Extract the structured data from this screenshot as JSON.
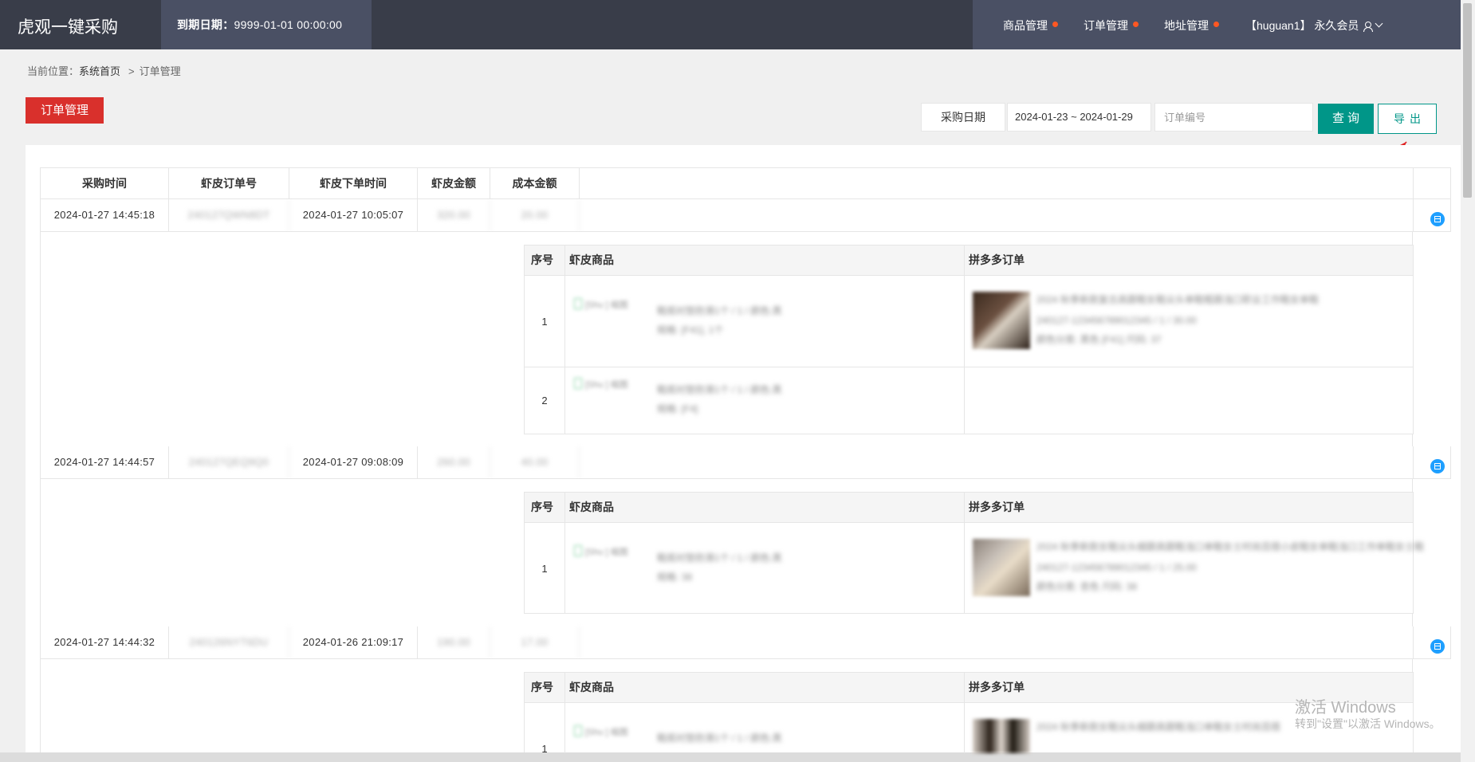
{
  "app": {
    "title": "虎观一键采购"
  },
  "expire": {
    "label": "到期日期：",
    "value": "9999-01-01 00:00:00"
  },
  "nav": {
    "items": [
      {
        "label": "商品管理",
        "dot_color": "#ff5722"
      },
      {
        "label": "订单管理",
        "dot_color": "#ff5722"
      },
      {
        "label": "地址管理",
        "dot_color": "#ff5722"
      }
    ],
    "user": "【huguan1】 永久会员"
  },
  "breadcrumb": {
    "prefix": "当前位置：",
    "home": "系统首页",
    "separator": ">",
    "current": "订单管理"
  },
  "page": {
    "title": "订单管理"
  },
  "filter": {
    "date_label": "采购日期",
    "date_value": "2024-01-23 ~ 2024-01-29",
    "order_placeholder": "订单编号",
    "query_label": "查询",
    "export_label": "导出"
  },
  "table": {
    "columns": [
      "采购时间",
      "虾皮订单号",
      "虾皮下单时间",
      "虾皮金额",
      "成本金额"
    ],
    "sub_columns": [
      "序号",
      "虾皮商品",
      "拼多多订单"
    ],
    "rows": [
      {
        "purchase_time": "2024-01-27 14:45:18",
        "order_no": "240127QWN8DT",
        "order_time": "2024-01-27 10:05:07",
        "amount": "320.00",
        "cost": "20.00",
        "items": [
          {
            "index": "1",
            "img": "[Shu ] 缩图",
            "line1": "鞋底衬垫防滑1个 / 1 / 颜色:黑",
            "line2": "规格: [F41], 1个",
            "has_pdd": true,
            "pdd1": "2024 秋季新款复古高跟鞋女鞋尖头单鞋粗跟浅口职业工作鞋女单鞋",
            "pdd2": "240127-123456789012345 / 1 / 30.00",
            "pdd3": "颜色分类: 黑色 [F41] 尺码: 37"
          },
          {
            "index": "2",
            "img": "[Shu ] 缩图",
            "line1": "鞋底衬垫防滑1个 / 1 / 颜色:黑",
            "line2": "规格: [F4]",
            "has_pdd": false,
            "pdd1": "",
            "pdd2": "",
            "pdd3": ""
          }
        ]
      },
      {
        "purchase_time": "2024-01-27 14:44:57",
        "order_no": "240127QEQ9Q0",
        "order_time": "2024-01-27 09:08:09",
        "amount": "260.00",
        "cost": "40.00",
        "items": [
          {
            "index": "1",
            "img": "[Shu ] 缩图",
            "line1": "鞋底衬垫防滑1个 / 1 / 颜色:黑",
            "line2": "规格: 38",
            "has_pdd": true,
            "pdd1": "2024 秋季新款女鞋尖头细跟高跟鞋浅口单鞋女士时尚百搭小皮鞋女单鞋浅口工作单鞋女士鞋",
            "pdd2": "240127-123456789012345 / 1 / 25.00",
            "pdd3": "颜色分类: 杏色 尺码: 38"
          }
        ]
      },
      {
        "purchase_time": "2024-01-27 14:44:32",
        "order_no": "240126NYT6DU",
        "order_time": "2024-01-26 21:09:17",
        "amount": "190.00",
        "cost": "17.00",
        "items": [
          {
            "index": "1",
            "img": "[Shu ] 缩图",
            "line1": "鞋底衬垫防滑1个 / 1 / 颜色:黑",
            "line2": "",
            "has_pdd": true,
            "pdd1": "2024 秋季新款女鞋尖头细跟高跟鞋浅口单鞋女士时尚百搭",
            "pdd2": "",
            "pdd3": ""
          }
        ]
      }
    ]
  },
  "watermark": {
    "line1": "激活 Windows",
    "line2": "转到\"设置\"以激活 Windows。"
  },
  "colors": {
    "accent": "#009688",
    "brand": "#d9302c",
    "topbar": "#393d49",
    "badge": "#1e9fff"
  }
}
